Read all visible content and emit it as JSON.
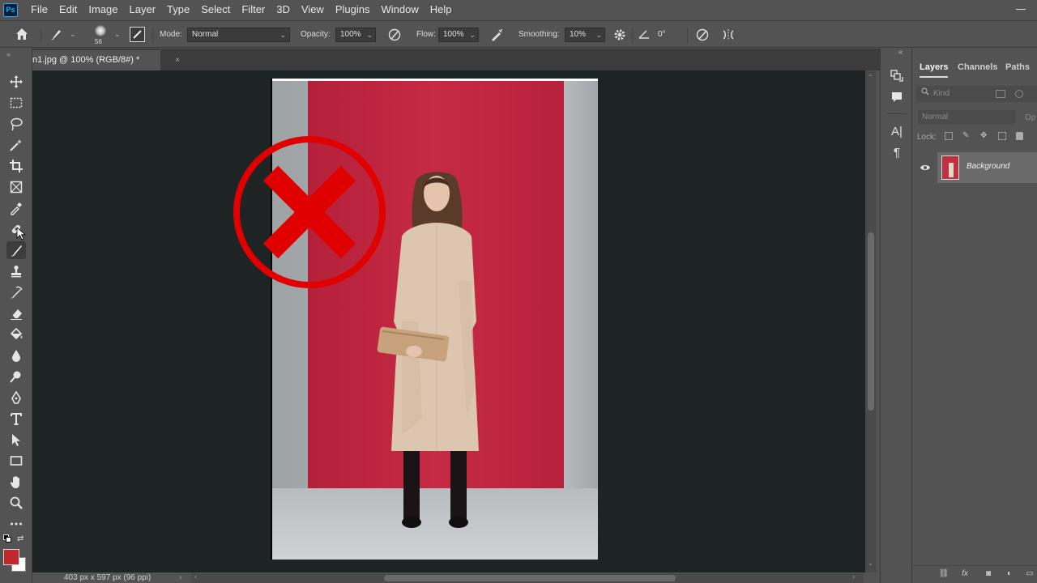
{
  "app": {
    "logo": "Ps"
  },
  "menu": [
    "File",
    "Edit",
    "Image",
    "Layer",
    "Type",
    "Select",
    "Filter",
    "3D",
    "View",
    "Plugins",
    "Window",
    "Help"
  ],
  "options": {
    "brush_size": "56",
    "mode_label": "Mode:",
    "mode_value": "Normal",
    "opacity_label": "Opacity:",
    "opacity_value": "100%",
    "flow_label": "Flow:",
    "flow_value": "100%",
    "smoothing_label": "Smoothing:",
    "smoothing_value": "10%",
    "angle_value": "0°"
  },
  "document": {
    "tab_title": "n1.jpg @ 100% (RGB/8#) *",
    "close_glyph": "×",
    "status": "403 px x 597 px (96 ppi)"
  },
  "panel": {
    "tabs": [
      "Layers",
      "Channels",
      "Paths"
    ],
    "search_placeholder": "Kind",
    "blend_mode": "Normal",
    "opacity_short": "Op",
    "lock_label": "Lock:",
    "layer_name": "Background"
  },
  "colors": {
    "foreground": "#c1272d",
    "background": "#ffffff",
    "accent": "#31a8ff",
    "overlay_red": "#e00000"
  },
  "icons": {
    "toolbar": [
      "move-icon",
      "marquee-icon",
      "lasso-icon",
      "magic-wand-icon",
      "crop-icon",
      "frame-icon",
      "eyedropper-icon",
      "healing-brush-icon",
      "brush-icon",
      "clone-stamp-icon",
      "history-brush-icon",
      "eraser-icon",
      "paint-bucket-icon",
      "blur-icon",
      "dodge-icon",
      "pen-icon",
      "type-icon",
      "path-selection-icon",
      "rectangle-icon",
      "hand-icon",
      "zoom-icon",
      "more-tools-icon"
    ]
  }
}
